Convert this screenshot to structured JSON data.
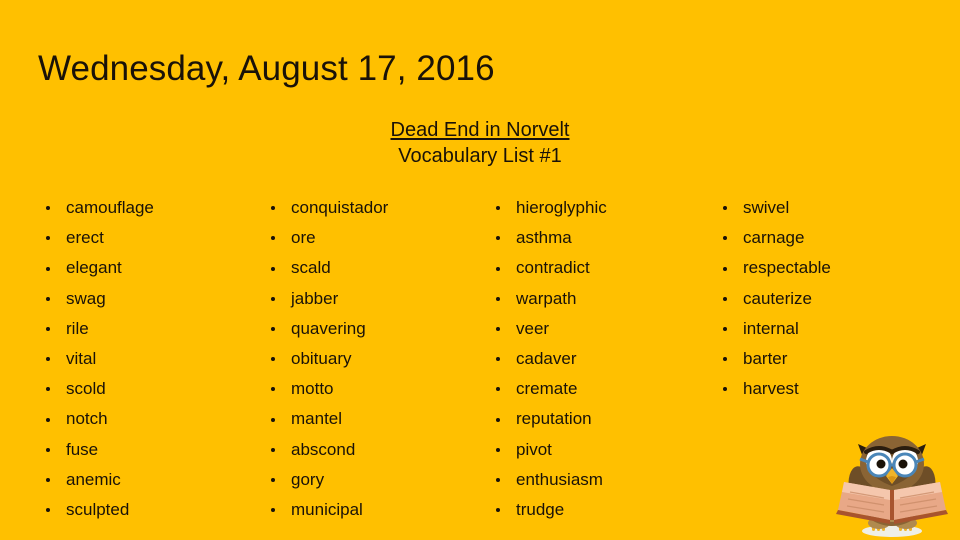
{
  "slide": {
    "background_color": "#FFC000",
    "text_color": "#1a1208",
    "title": "Wednesday, August 17, 2016",
    "subtitle": {
      "book_title": "Dead End in Norvelt",
      "list_label": "Vocabulary List #1"
    },
    "decoration": {
      "owl_icon_name": "owl-reading-book-icon",
      "body_color": "#8a6434",
      "belly_color": "#b08a4e",
      "glasses_color": "#4a86b8",
      "beak_color": "#f0b429",
      "book_cover_color": "#a8542e",
      "book_page_color": "#e8a887"
    }
  },
  "vocabulary": {
    "columns": [
      {
        "index": 0,
        "words": [
          "camouflage",
          "erect",
          "elegant",
          "swag",
          "rile",
          "vital",
          "scold",
          "notch",
          "fuse",
          "anemic",
          "sculpted"
        ]
      },
      {
        "index": 1,
        "words": [
          "conquistador",
          "ore",
          "scald",
          "jabber",
          "quavering",
          "obituary",
          "motto",
          "mantel",
          "abscond",
          "gory",
          "municipal"
        ]
      },
      {
        "index": 2,
        "words": [
          "hieroglyphic",
          "asthma",
          "contradict",
          "warpath",
          "veer",
          "cadaver",
          "cremate",
          "reputation",
          "pivot",
          "enthusiasm",
          "trudge"
        ]
      },
      {
        "index": 3,
        "words": [
          "swivel",
          "carnage",
          "respectable",
          "cauterize",
          "internal",
          "barter",
          "harvest"
        ]
      }
    ]
  }
}
